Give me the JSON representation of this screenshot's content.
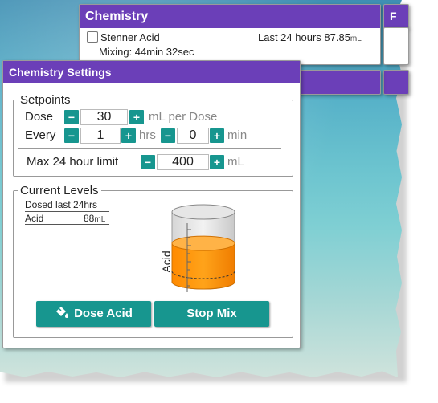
{
  "chemistry_panel": {
    "title": "Chemistry",
    "item_name": "Stenner Acid",
    "last24_text": "Last 24 hours 87.85",
    "last24_unit": "mL",
    "mixing_text": "Mixing: 44min 32sec"
  },
  "right_stub_letter": "F",
  "settings": {
    "title": "Chemistry Settings",
    "setpoints": {
      "legend": "Setpoints",
      "dose_label": "Dose",
      "dose_value": "30",
      "dose_unit": "mL per Dose",
      "every_label": "Every",
      "every_hrs_value": "1",
      "every_hrs_unit": "hrs",
      "every_min_value": "0",
      "every_min_unit": "min",
      "max_label": "Max 24 hour limit",
      "max_value": "400",
      "max_unit": "mL",
      "minus": "−",
      "plus": "+"
    },
    "levels": {
      "legend": "Current Levels",
      "dosed_header": "Dosed last 24hrs",
      "acid_label": "Acid",
      "acid_value": "88",
      "acid_unit": "mL",
      "tank_label": "Acid",
      "tank_fill_fraction": 0.55
    },
    "buttons": {
      "dose_label": "Dose Acid",
      "stop_label": "Stop Mix"
    }
  },
  "colors": {
    "title_bar": "#6b3fb8",
    "accent_button": "#17968f",
    "tank_fill": "#ff8a00"
  }
}
